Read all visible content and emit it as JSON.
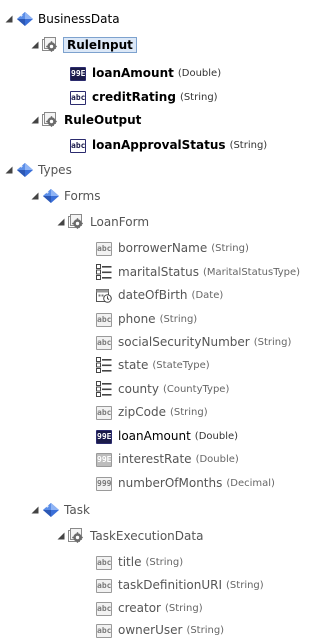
{
  "tree": {
    "business_data": {
      "label": "BusinessData",
      "rule_input": {
        "label": "RuleInput",
        "fields": [
          {
            "name": "loanAmount",
            "type": "(Double)"
          },
          {
            "name": "creditRating",
            "type": "(String)"
          }
        ]
      },
      "rule_output": {
        "label": "RuleOutput",
        "fields": [
          {
            "name": "loanApprovalStatus",
            "type": "(String)"
          }
        ]
      }
    },
    "types": {
      "label": "Types",
      "forms": {
        "label": "Forms",
        "loan_form": {
          "label": "LoanForm",
          "fields": [
            {
              "name": "borrowerName",
              "type": "(String)",
              "icon": "abc"
            },
            {
              "name": "maritalStatus",
              "type": "(MaritalStatusType)",
              "icon": "list"
            },
            {
              "name": "dateOfBirth",
              "type": "(Date)",
              "icon": "calendar"
            },
            {
              "name": "phone",
              "type": "(String)",
              "icon": "abc"
            },
            {
              "name": "socialSecurityNumber",
              "type": "(String)",
              "icon": "abc"
            },
            {
              "name": "state",
              "type": "(StateType)",
              "icon": "list"
            },
            {
              "name": "county",
              "type": "(CountyType)",
              "icon": "list"
            },
            {
              "name": "zipCode",
              "type": "(String)",
              "icon": "abc"
            },
            {
              "name": "loanAmount",
              "type": "(Double)",
              "icon": "99e"
            },
            {
              "name": "interestRate",
              "type": "(Double)",
              "icon": "99e"
            },
            {
              "name": "numberOfMonths",
              "type": "(Decimal)",
              "icon": "999"
            }
          ]
        }
      },
      "task": {
        "label": "Task",
        "task_execution_data": {
          "label": "TaskExecutionData",
          "fields": [
            {
              "name": "title",
              "type": "(String)"
            },
            {
              "name": "taskDefinitionURI",
              "type": "(String)"
            },
            {
              "name": "creator",
              "type": "(String)"
            },
            {
              "name": "ownerUser",
              "type": "(String)"
            }
          ]
        }
      }
    }
  },
  "icon_labels": {
    "abc": "abc",
    "e99": "99E",
    "n999": "999"
  }
}
